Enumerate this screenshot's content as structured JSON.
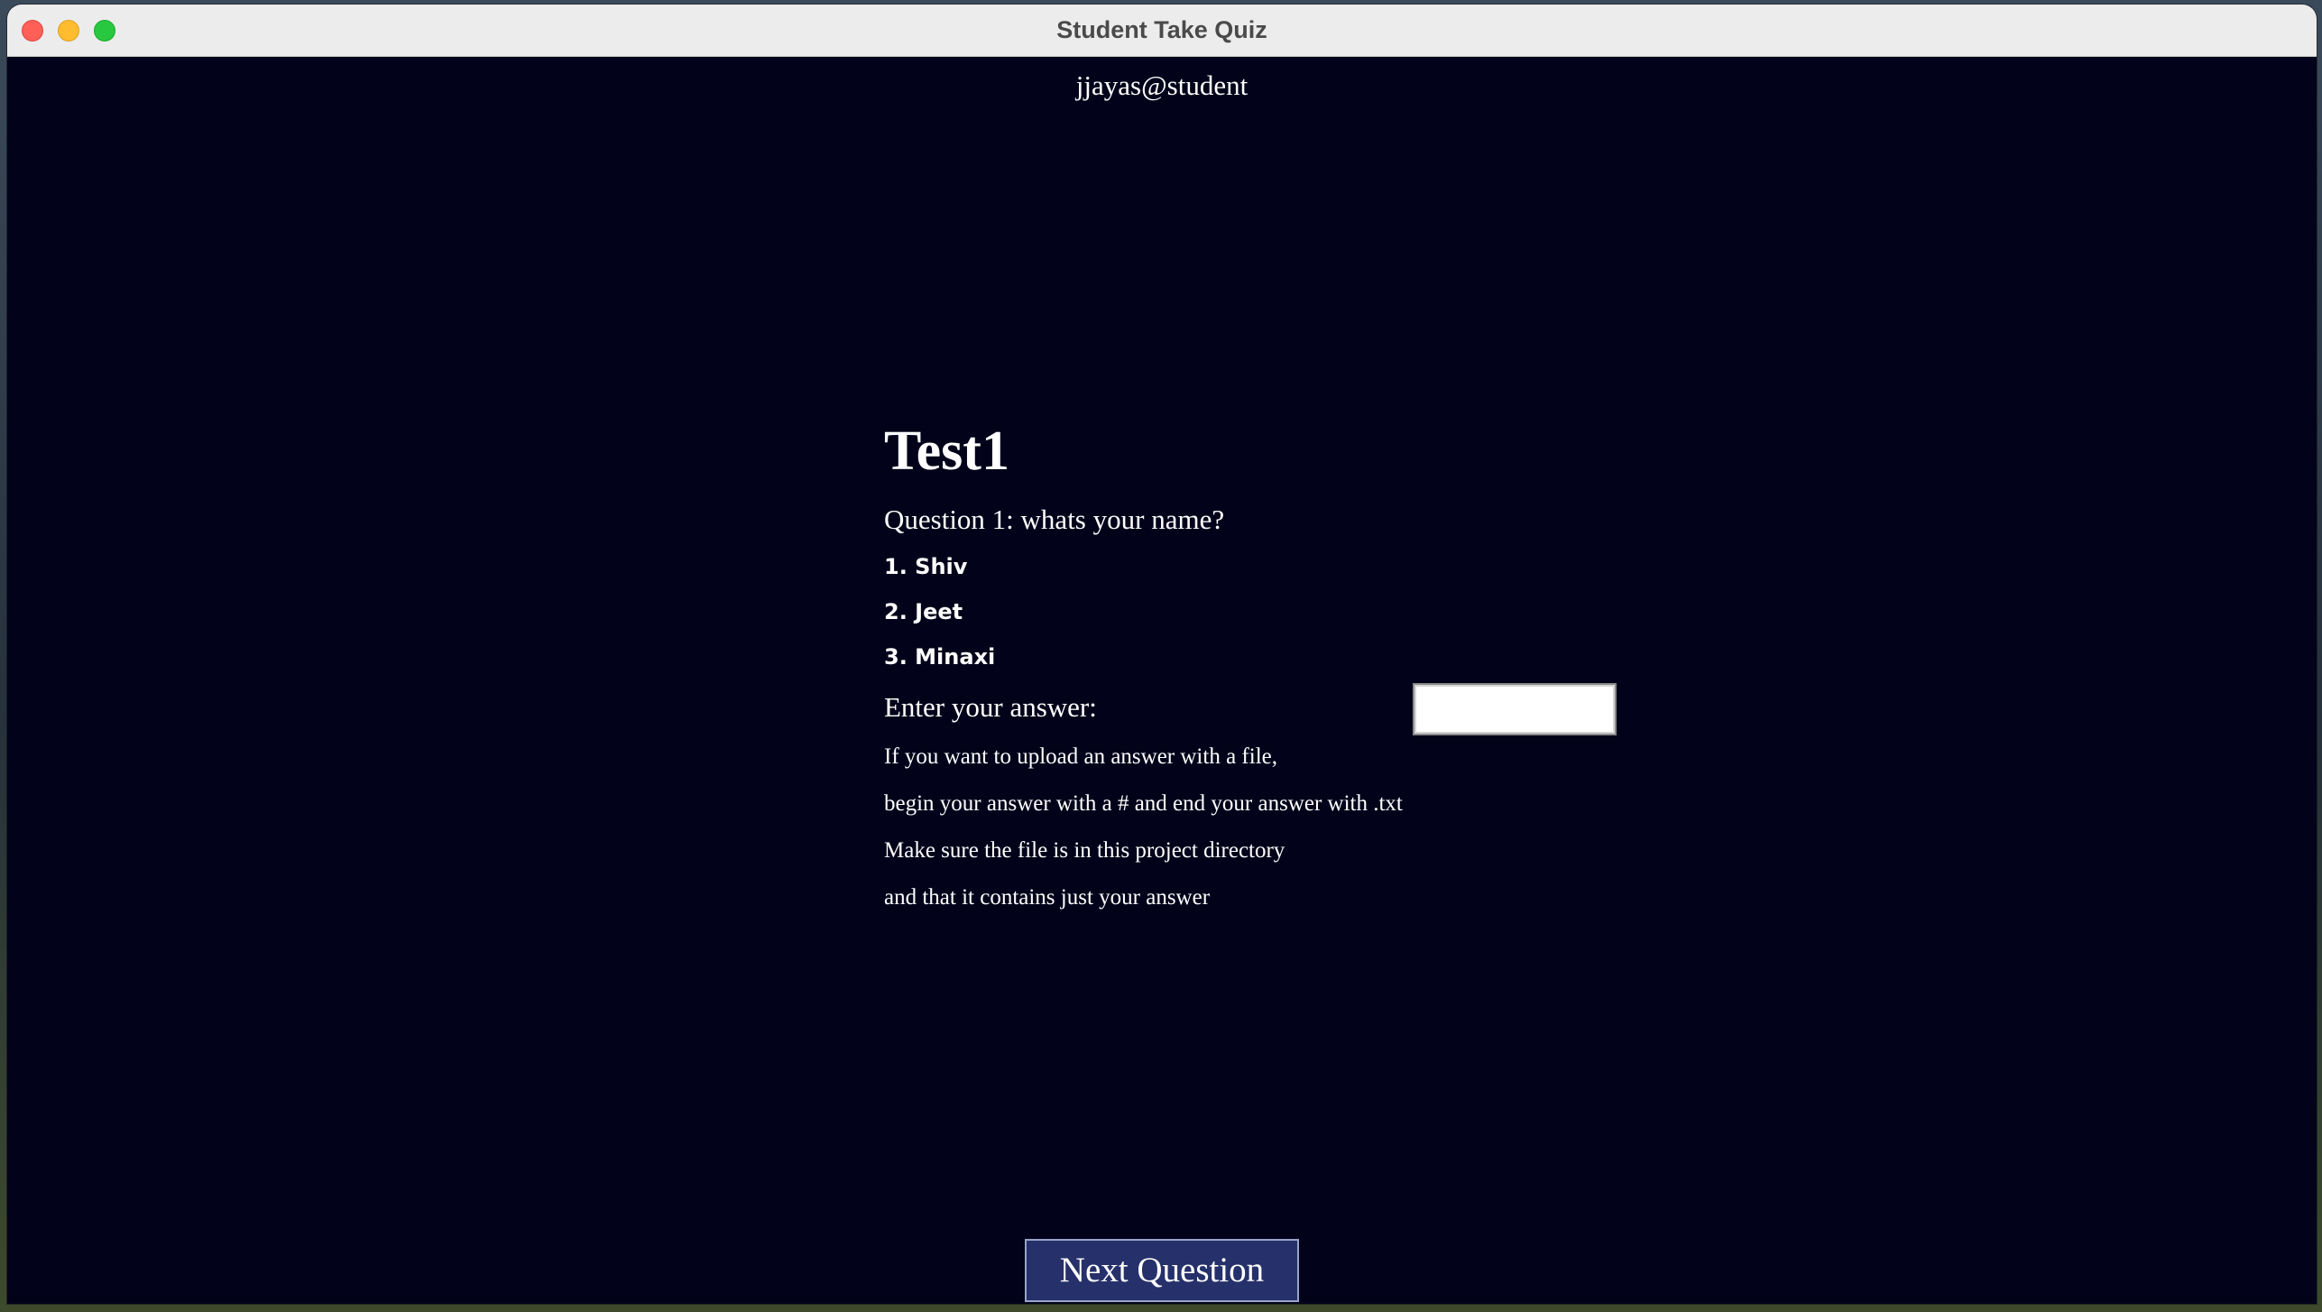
{
  "window": {
    "title": "Student Take Quiz"
  },
  "user": {
    "label": "jjayas@student"
  },
  "quiz": {
    "title": "Test1",
    "question": "Question 1: whats your name?",
    "options": [
      "1. Shiv",
      "2. Jeet",
      "3. Minaxi"
    ],
    "answer_label": "Enter your answer:",
    "answer_value": "",
    "hints": [
      "If you want to upload an answer with a file,",
      "begin your answer with a # and end your answer with .txt",
      "Make sure the file is in this project directory",
      "and that it contains just your answer"
    ]
  },
  "actions": {
    "next_label": "Next Question"
  },
  "colors": {
    "background": "#02031a",
    "button": "#26306a",
    "close": "#fe5f57",
    "minimize": "#febc2e",
    "maximize": "#28c840"
  }
}
